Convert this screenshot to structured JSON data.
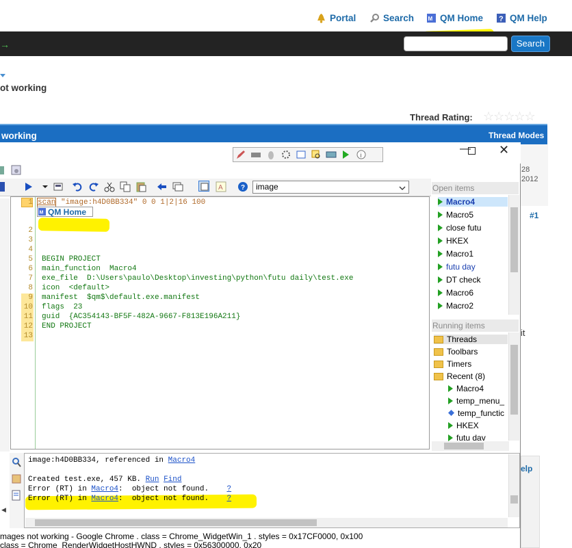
{
  "forum": {
    "top_links": [
      "Portal",
      "Search",
      "QM Home",
      "QM Help"
    ],
    "search_button": "Search",
    "search_value": "",
    "thread_title_fragment": "ot working",
    "thread_rating_label": "Thread Rating:",
    "thread_bar_title": "working",
    "thread_modes": "Thread Modes",
    "post_number": "#1",
    "side_fragments": [
      "28",
      "2012",
      "it",
      "elp"
    ]
  },
  "qm_window": {
    "toolbar_dropdown_value": "image",
    "gutter_first_line": "1",
    "first_line_keyword": "scan",
    "first_line_rest": " \"image:h4D0BB334\" 0 0 1|2|16 100",
    "image_label": "QM Home",
    "line_numbers": [
      "2",
      "3",
      "4",
      "5",
      "6",
      "7",
      "8",
      "9",
      "10",
      "11",
      "12",
      "13"
    ],
    "code_lines": [
      "BEGIN PROJECT",
      "main_function  Macro4",
      "exe_file  D:\\Users\\paulo\\Desktop\\investing\\python\\futu daily\\test.exe",
      "icon  <default>",
      "manifest  $qm$\\default.exe.manifest",
      "flags  23",
      "guid  {AC354143-BF5F-482A-9667-F813E196A211}",
      "END PROJECT"
    ],
    "open_items_header": "Open items",
    "open_items": [
      "Macro4",
      "Macro5",
      "close futu",
      "HKEX",
      "Macro1",
      "futu day",
      "DT check",
      "Macro6",
      "Macro2"
    ],
    "running_items_header": "Running items",
    "running_items": [
      "Threads",
      "Toolbars",
      "Timers",
      "Recent (8)",
      "Macro4",
      "temp_menu_",
      "temp_functic",
      "HKEX",
      "futu dav"
    ],
    "output": {
      "line1_text": "image:h4D0BB334, referenced in ",
      "line1_link": "Macro4",
      "line2_text": "Created test.exe, 457 KB. ",
      "line2_run": "Run",
      "line2_find": "Find",
      "error_prefix": "Error (RT) in ",
      "error_link": "Macro4",
      "error_msg": ":  object not found.    ",
      "error_q": "?"
    }
  },
  "status": {
    "line1": "mages not working - Google Chrome  .  class = Chrome_WidgetWin_1  .  styles = 0x17CF0000, 0x100",
    "line2": "class = Chrome_RenderWidgetHostHWND  .  styles = 0x56300000, 0x20"
  },
  "colors": {
    "nav_bar": "#232323",
    "thread_bar": "#1b6ec2",
    "highlight": "#fff200",
    "link": "#1d6aa8"
  }
}
